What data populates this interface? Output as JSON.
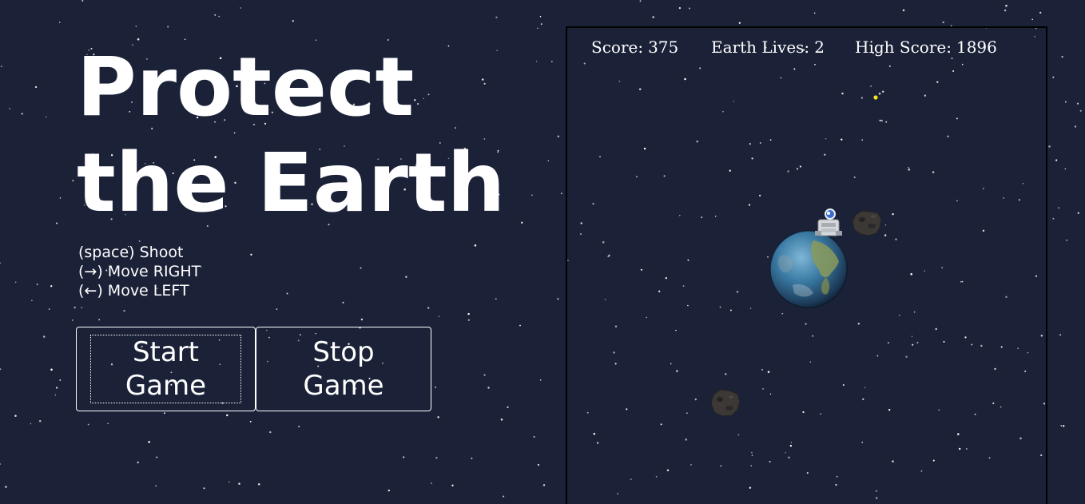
{
  "title": {
    "line1": "Protect",
    "line2": "the Earth"
  },
  "controls": [
    {
      "key": "(space)",
      "action": "Shoot"
    },
    {
      "key": "(→)",
      "action": "Move RIGHT"
    },
    {
      "key": "(←)",
      "action": "Move LEFT"
    }
  ],
  "buttons": {
    "start": {
      "line1": "Start",
      "line2": "Game"
    },
    "stop": {
      "line1": "Stop",
      "line2": "Game"
    }
  },
  "hud": {
    "score_label": "Score:",
    "score_value": "375",
    "lives_label": "Earth Lives:",
    "lives_value": "2",
    "high_label": "High Score:",
    "high_value": "1896"
  },
  "colors": {
    "background": "#1b2238",
    "text": "#ffffff",
    "star": "#ffffff",
    "bullet": "#f5e61e",
    "asteroid": "#3b3836",
    "earth_ocean": "#2d6c96"
  },
  "sprites": {
    "earth": "earth-icon",
    "ship": "spaceship-icon",
    "asteroid": "asteroid-icon",
    "bullet": "bullet-icon"
  }
}
